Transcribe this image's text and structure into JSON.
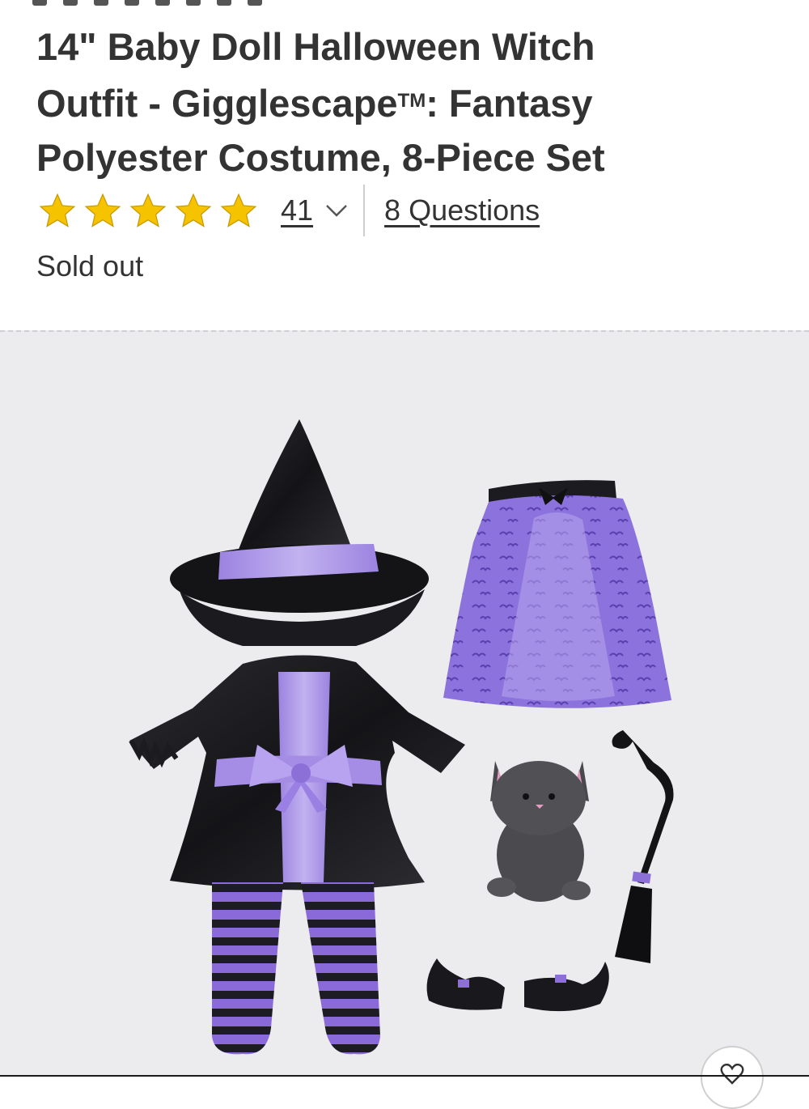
{
  "product": {
    "title_line1": "14\" Baby Doll Halloween Witch",
    "title_line2_a": "Outfit - Gigglescape",
    "title_tm": "TM",
    "title_line2_b": ": Fantasy",
    "title_line3": "Polyester Costume, 8-Piece Set",
    "rating_value": 5,
    "rating_max": 5,
    "review_count": "41",
    "questions_label": "8 Questions",
    "stock_status": "Sold out"
  },
  "icons": {
    "star": "star-icon",
    "review_toggle": "chevron-down-icon",
    "favorite": "heart-icon"
  },
  "colors": {
    "star_fill": "#f5c300",
    "text": "#333333",
    "image_bg": "#ececee",
    "purple": "#8e6fd6",
    "black_satin": "#1c1c20"
  }
}
